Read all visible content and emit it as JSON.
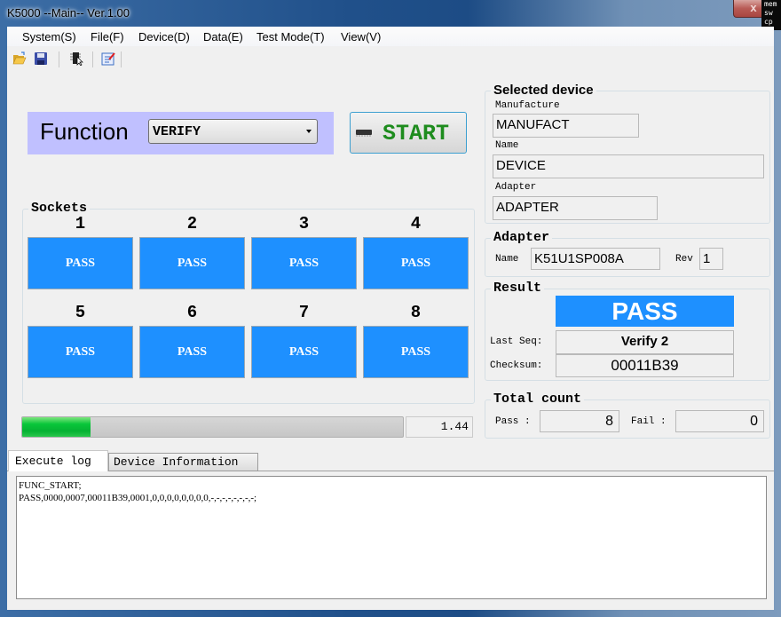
{
  "window": {
    "title": "K5000  --Main-- Ver.1.00",
    "close_label": "x",
    "tooltip_lines": [
      "mem",
      "sw",
      "cp"
    ]
  },
  "menu": [
    {
      "label": "System(S)"
    },
    {
      "label": "File(F)"
    },
    {
      "label": "Device(D)"
    },
    {
      "label": "Data(E)"
    },
    {
      "label": "Test Mode(T)"
    },
    {
      "label": "View(V)"
    }
  ],
  "toolbar": {
    "icons": [
      "open-folder-icon",
      "save-icon",
      "select-device-icon",
      "edit-icon"
    ]
  },
  "function": {
    "label": "Function",
    "selected": "VERIFY"
  },
  "start_button": {
    "label": "START"
  },
  "sockets": {
    "title": "Sockets",
    "items": [
      {
        "number": "1",
        "status": "PASS"
      },
      {
        "number": "2",
        "status": "PASS"
      },
      {
        "number": "3",
        "status": "PASS"
      },
      {
        "number": "4",
        "status": "PASS"
      },
      {
        "number": "5",
        "status": "PASS"
      },
      {
        "number": "6",
        "status": "PASS"
      },
      {
        "number": "7",
        "status": "PASS"
      },
      {
        "number": "8",
        "status": "PASS"
      }
    ],
    "pass_color": "#1e90ff"
  },
  "progress": {
    "fraction": 0.18,
    "elapsed": "1.44"
  },
  "selected_device": {
    "title": "Selected device",
    "manufacture_label": "Manufacture",
    "manufacture": "MANUFACT",
    "name_label": "Name",
    "name": "DEVICE",
    "adapter_label": "Adapter",
    "adapter": "ADAPTER"
  },
  "adapter": {
    "title": "Adapter",
    "name_label": "Name",
    "name": "K51U1SP008A",
    "rev_label": "Rev",
    "rev": "1"
  },
  "result": {
    "title": "Result",
    "status": "PASS",
    "last_seq_label": "Last Seq:",
    "last_seq": "Verify 2",
    "checksum_label": "Checksum:",
    "checksum": "00011B39"
  },
  "total_count": {
    "title": "Total count",
    "pass_label": "Pass :",
    "pass": "8",
    "fail_label": "Fail :",
    "fail": "0"
  },
  "tabs": [
    {
      "label": "Execute log",
      "active": true
    },
    {
      "label": "Device Information",
      "active": false
    }
  ],
  "log": {
    "lines": "FUNC_START;\nPASS,0000,0007,00011B39,0001,0,0,0,0,0,0,0,0,-,-,-,-,-,-,-,-;"
  }
}
